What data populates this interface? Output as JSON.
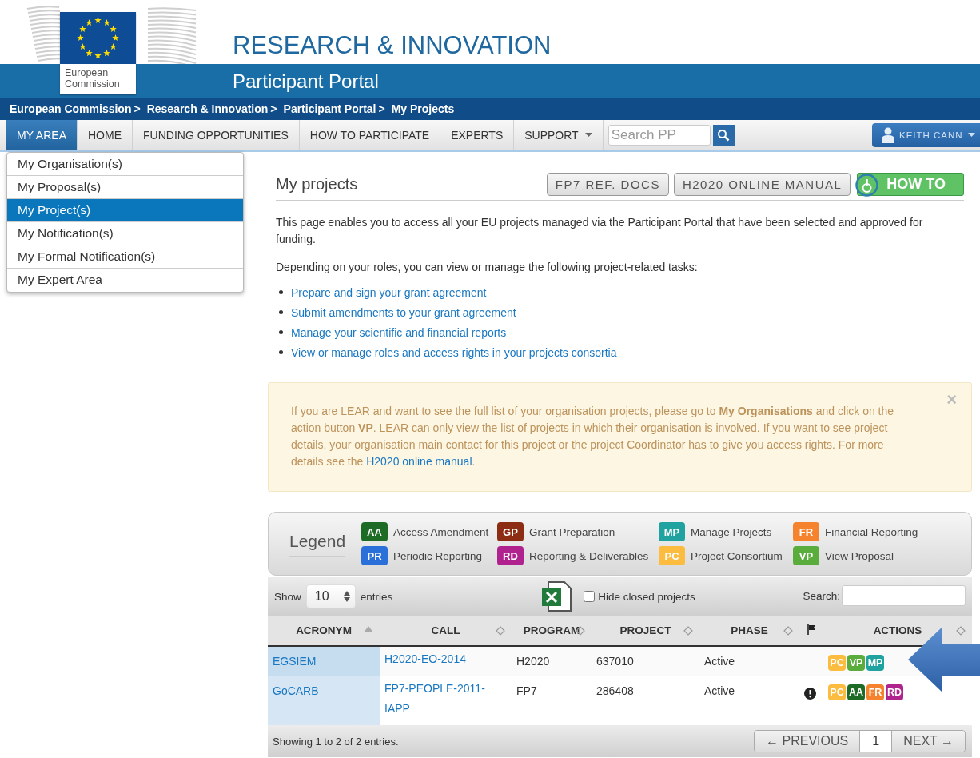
{
  "header": {
    "title": "RESEARCH & INNOVATION",
    "subtitle": "Participant Portal",
    "logo_text": "European Commission"
  },
  "breadcrumb": [
    {
      "label": "European Commission",
      "separator": ">"
    },
    {
      "label": "Research & Innovation",
      "separator": ">"
    },
    {
      "label": "Participant Portal",
      "separator": ">"
    },
    {
      "label": "My Projects"
    }
  ],
  "nav": {
    "items": [
      {
        "label": "MY AREA",
        "selected": true,
        "dropdown": false
      },
      {
        "label": "HOME",
        "selected": false,
        "dropdown": false
      },
      {
        "label": "FUNDING OPPORTUNITIES",
        "selected": false,
        "dropdown": false
      },
      {
        "label": "HOW TO PARTICIPATE",
        "selected": false,
        "dropdown": false
      },
      {
        "label": "EXPERTS",
        "selected": false,
        "dropdown": false
      },
      {
        "label": "SUPPORT",
        "selected": false,
        "dropdown": true
      }
    ],
    "search_placeholder": "Search PP",
    "user": "KEITH CANN"
  },
  "menu": [
    {
      "label": "My Organisation(s)",
      "selected": false
    },
    {
      "label": "My Proposal(s)",
      "selected": false
    },
    {
      "label": "My Project(s)",
      "selected": true
    },
    {
      "label": "My Notification(s)",
      "selected": false
    },
    {
      "label": "My Formal Notification(s)",
      "selected": false
    },
    {
      "label": "My Expert Area",
      "selected": false
    }
  ],
  "page": {
    "title": "My projects",
    "buttons": [
      {
        "label": "FP7 REF. DOCS",
        "kind": "plain"
      },
      {
        "label": "H2020 ONLINE MANUAL",
        "kind": "plain"
      },
      {
        "label": "HOW TO",
        "kind": "howto"
      }
    ],
    "intro": "This page enables you to access all your EU projects managed via the Participant Portal that have been selected and approved for funding.",
    "tasks_intro": "Depending on your roles, you can view or manage the following project-related tasks:",
    "tasks": [
      "Prepare and sign your grant agreement",
      "Submit amendments to your grant agreement",
      "Manage your scientific and financial reports",
      "View or manage roles and access rights in your projects consortia"
    ]
  },
  "alert": {
    "text_before": "If you are LEAR and want to see the full list of your organisation projects, please go to **My Organisations** and click on the action button **VP**. LEAR can only view the list of projects in which their organisation is involved. If you want to see project details, your organisation main contact for this project or the project Coordinator has to give you access rights. For more details see the ",
    "link": "H2020 online manual",
    "text_after": ".",
    "close": "×"
  },
  "legend": {
    "title": "Legend",
    "items": [
      {
        "code": "AA",
        "label": "Access Amendment",
        "color": "#1d6b25"
      },
      {
        "code": "GP",
        "label": "Grant Preparation",
        "color": "#8c2c12"
      },
      {
        "code": "MP",
        "label": "Manage Projects",
        "color": "#20a3a0"
      },
      {
        "code": "FR",
        "label": "Financial Reporting",
        "color": "#f5822c"
      },
      {
        "code": "PR",
        "label": "Periodic Reporting",
        "color": "#2b6fd8"
      },
      {
        "code": "RD",
        "label": "Reporting & Deliverables",
        "color": "#b0228e"
      },
      {
        "code": "PC",
        "label": "Project Consortium",
        "color": "#fbbc40"
      },
      {
        "code": "VP",
        "label": "View Proposal",
        "color": "#5aac3c"
      }
    ]
  },
  "table": {
    "show_label": "Show",
    "page_size": "10",
    "entries_label": "entries",
    "hide_closed": {
      "label": "Hide closed projects",
      "checked": false
    },
    "search_label": "Search:",
    "columns": [
      {
        "label": "ACRONYM",
        "kind": "text",
        "sorted": true
      },
      {
        "label": "CALL",
        "kind": "text",
        "sorted": false
      },
      {
        "label": "PROGRAM",
        "kind": "text",
        "sorted": false
      },
      {
        "label": "PROJECT",
        "kind": "text",
        "sorted": false
      },
      {
        "label": "PHASE",
        "kind": "text",
        "sorted": false
      },
      {
        "kind": "flag"
      },
      {
        "label": "ACTIONS",
        "kind": "text",
        "sorted": false
      }
    ],
    "rows": [
      {
        "acronym": "EGSIEM",
        "call": "H2020-EO-2014",
        "program": "H2020",
        "project": "637010",
        "phase": "Active",
        "alert": false,
        "actions": [
          {
            "code": "PC",
            "color": "#fbbc40"
          },
          {
            "code": "VP",
            "color": "#5aac3c"
          },
          {
            "code": "MP",
            "color": "#20a3a0"
          }
        ]
      },
      {
        "acronym": "GoCARB",
        "call": "FP7-PEOPLE-2011-IAPP",
        "program": "FP7",
        "project": "286408",
        "phase": "Active",
        "alert": true,
        "actions": [
          {
            "code": "PC",
            "color": "#fbbc40"
          },
          {
            "code": "AA",
            "color": "#1d6b25"
          },
          {
            "code": "FR",
            "color": "#f5822c"
          },
          {
            "code": "RD",
            "color": "#b0228e"
          }
        ]
      }
    ],
    "footer": {
      "info": "Showing 1 to 2 of 2 entries.",
      "previous": "← PREVIOUS",
      "page": "1",
      "next": "NEXT →"
    }
  }
}
